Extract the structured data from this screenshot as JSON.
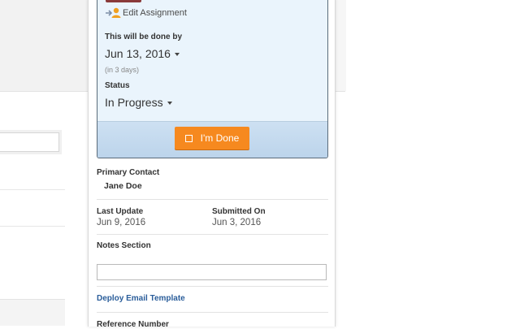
{
  "assignment": {
    "edit_label": "Edit Assignment",
    "due_label": "This will be done by",
    "due_date": "Jun 13, 2016",
    "due_hint": "(in 3 days)",
    "status_label": "Status",
    "status_value": "In Progress",
    "done_button": "I'm Done"
  },
  "details": {
    "primary_contact_label": "Primary Contact",
    "primary_contact": "Jane Doe",
    "last_update_label": "Last Update",
    "last_update": "Jun 9, 2016",
    "submitted_label": "Submitted On",
    "submitted": "Jun 3, 2016",
    "notes_label": "Notes Section",
    "notes_value": "",
    "deploy_link": "Deploy Email Template",
    "reference_label": "Reference Number"
  },
  "colors": {
    "accent_orange": "#f6891f",
    "link_blue": "#2a5d9a",
    "card_bg": "#eaf4fc"
  }
}
